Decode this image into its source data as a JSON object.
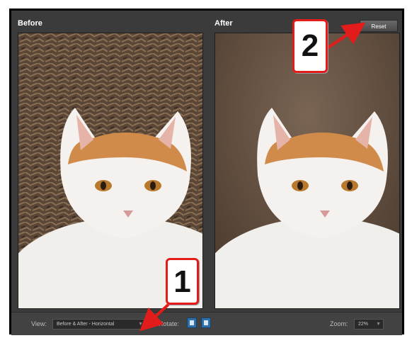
{
  "panels": {
    "before_title": "Before",
    "after_title": "After"
  },
  "reset_label": "Reset",
  "bottom_bar": {
    "view_label": "View:",
    "view_value": "Before & After - Horizontal",
    "rotate_label": "Rotate:",
    "zoom_label": "Zoom:",
    "zoom_value": "22%"
  },
  "callouts": {
    "one": "1",
    "two": "2"
  },
  "colors": {
    "panel_bg": "#3b3b3b",
    "callout_border": "#e21b1b",
    "arrow": "#e21b1b"
  },
  "icons": [
    "rotate-left-icon",
    "rotate-right-icon",
    "dropdown-arrow-icon"
  ]
}
